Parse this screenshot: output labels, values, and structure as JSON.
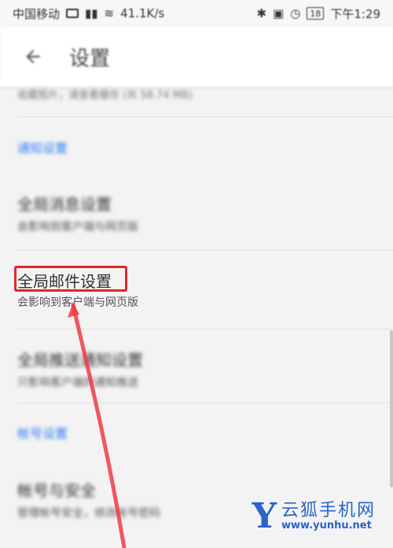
{
  "status_bar": {
    "carrier": "中国移动",
    "speed": "41.1K/s",
    "battery": "18",
    "time": "下午1:29"
  },
  "app_bar": {
    "title": "设置"
  },
  "list": {
    "clipped_row_text": "收藏图片，请查看缓存 (共 58.74 MB)",
    "section_notification": "通知设置",
    "items": [
      {
        "title": "全局消息设置",
        "subtitle": "会影响到客户端与网页版"
      },
      {
        "title": "全局邮件设置",
        "subtitle": "会影响到客户端与网页版"
      },
      {
        "title": "全局推送通知设置",
        "subtitle": "只影响客户端的通知推送"
      }
    ],
    "section_account": "帐号设置",
    "account_items": [
      {
        "title": "帐号与安全",
        "subtitle": "管理帐号安全，修改帐号密码"
      }
    ]
  },
  "watermark": {
    "logo": "Y",
    "name": "云狐手机网",
    "url": "www.yunhu.net"
  },
  "colors": {
    "accent": "#2f7bf5",
    "highlight": "#e0262b",
    "watermark": "#2a63c9"
  }
}
